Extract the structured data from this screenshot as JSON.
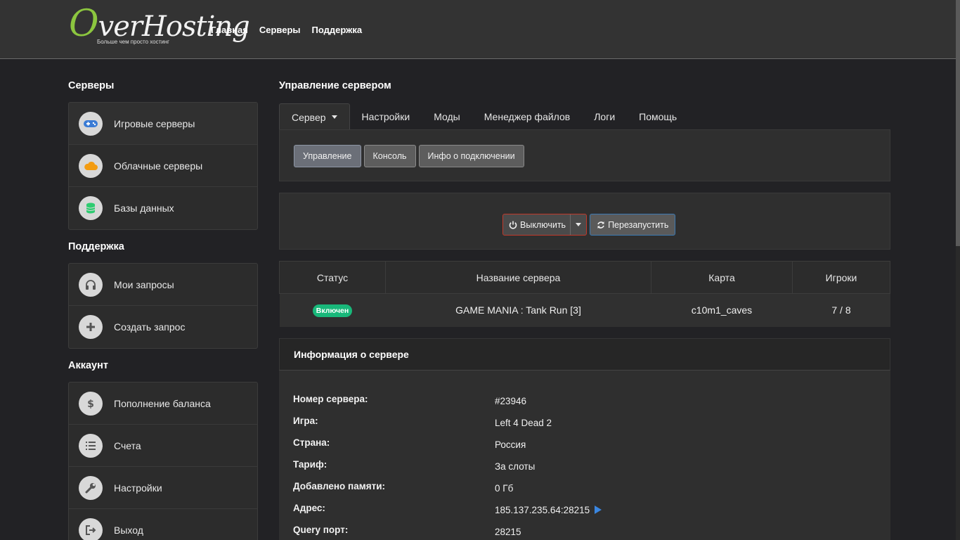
{
  "header": {
    "logo_text_initial": "O",
    "logo_text_rest": "verHosting",
    "logo_tagline": "Больше чем просто хостинг",
    "nav": [
      "Главная",
      "Серверы",
      "Поддержка"
    ]
  },
  "sidebar": {
    "servers_title": "Серверы",
    "servers_items": [
      {
        "label": "Игровые серверы",
        "icon": "gamepad-icon",
        "color": "#3a7bd5"
      },
      {
        "label": "Облачные серверы",
        "icon": "cloud-icon",
        "color": "#f39c12"
      },
      {
        "label": "Базы данных",
        "icon": "database-icon",
        "color": "#2ecc71"
      }
    ],
    "support_title": "Поддержка",
    "support_items": [
      {
        "label": "Мои запросы",
        "icon": "headphones-icon"
      },
      {
        "label": "Создать запрос",
        "icon": "plus-icon"
      }
    ],
    "account_title": "Аккаунт",
    "account_items": [
      {
        "label": "Пополнение баланса",
        "icon": "dollar-icon"
      },
      {
        "label": "Счета",
        "icon": "list-icon"
      },
      {
        "label": "Настройки",
        "icon": "wrench-icon"
      },
      {
        "label": "Выход",
        "icon": "logout-icon"
      }
    ]
  },
  "main": {
    "title": "Управление сервером",
    "tabs": [
      "Сервер",
      "Настройки",
      "Моды",
      "Менеджер файлов",
      "Логи",
      "Помощь"
    ],
    "subtabs": [
      "Управление",
      "Консоль",
      "Инфо о подключении"
    ],
    "power_off_label": "Выключить",
    "restart_label": "Перезапустить"
  },
  "server_table": {
    "headers": [
      "Статус",
      "Название сервера",
      "Карта",
      "Игроки"
    ],
    "row": {
      "status": "Включен",
      "name": "GAME MANIA : Tank Run [3]",
      "map": "c10m1_caves",
      "players": "7 / 8"
    }
  },
  "info": {
    "title": "Информация о сервере",
    "rows": [
      {
        "k": "Номер сервера:",
        "v": "#23946"
      },
      {
        "k": "Игра:",
        "v": "Left 4 Dead 2"
      },
      {
        "k": "Страна:",
        "v": "Россия"
      },
      {
        "k": "Тариф:",
        "v": "За слоты"
      },
      {
        "k": "Добавлено памяти:",
        "v": "0 Гб"
      },
      {
        "k": "Адрес:",
        "v": "185.137.235.64:28215"
      },
      {
        "k": "Query порт:",
        "v": "28215"
      }
    ]
  },
  "colors": {
    "accent_green": "#8cc63f",
    "status_on": "#18b87a",
    "danger": "#c0392b",
    "info": "#3c7ab3"
  }
}
